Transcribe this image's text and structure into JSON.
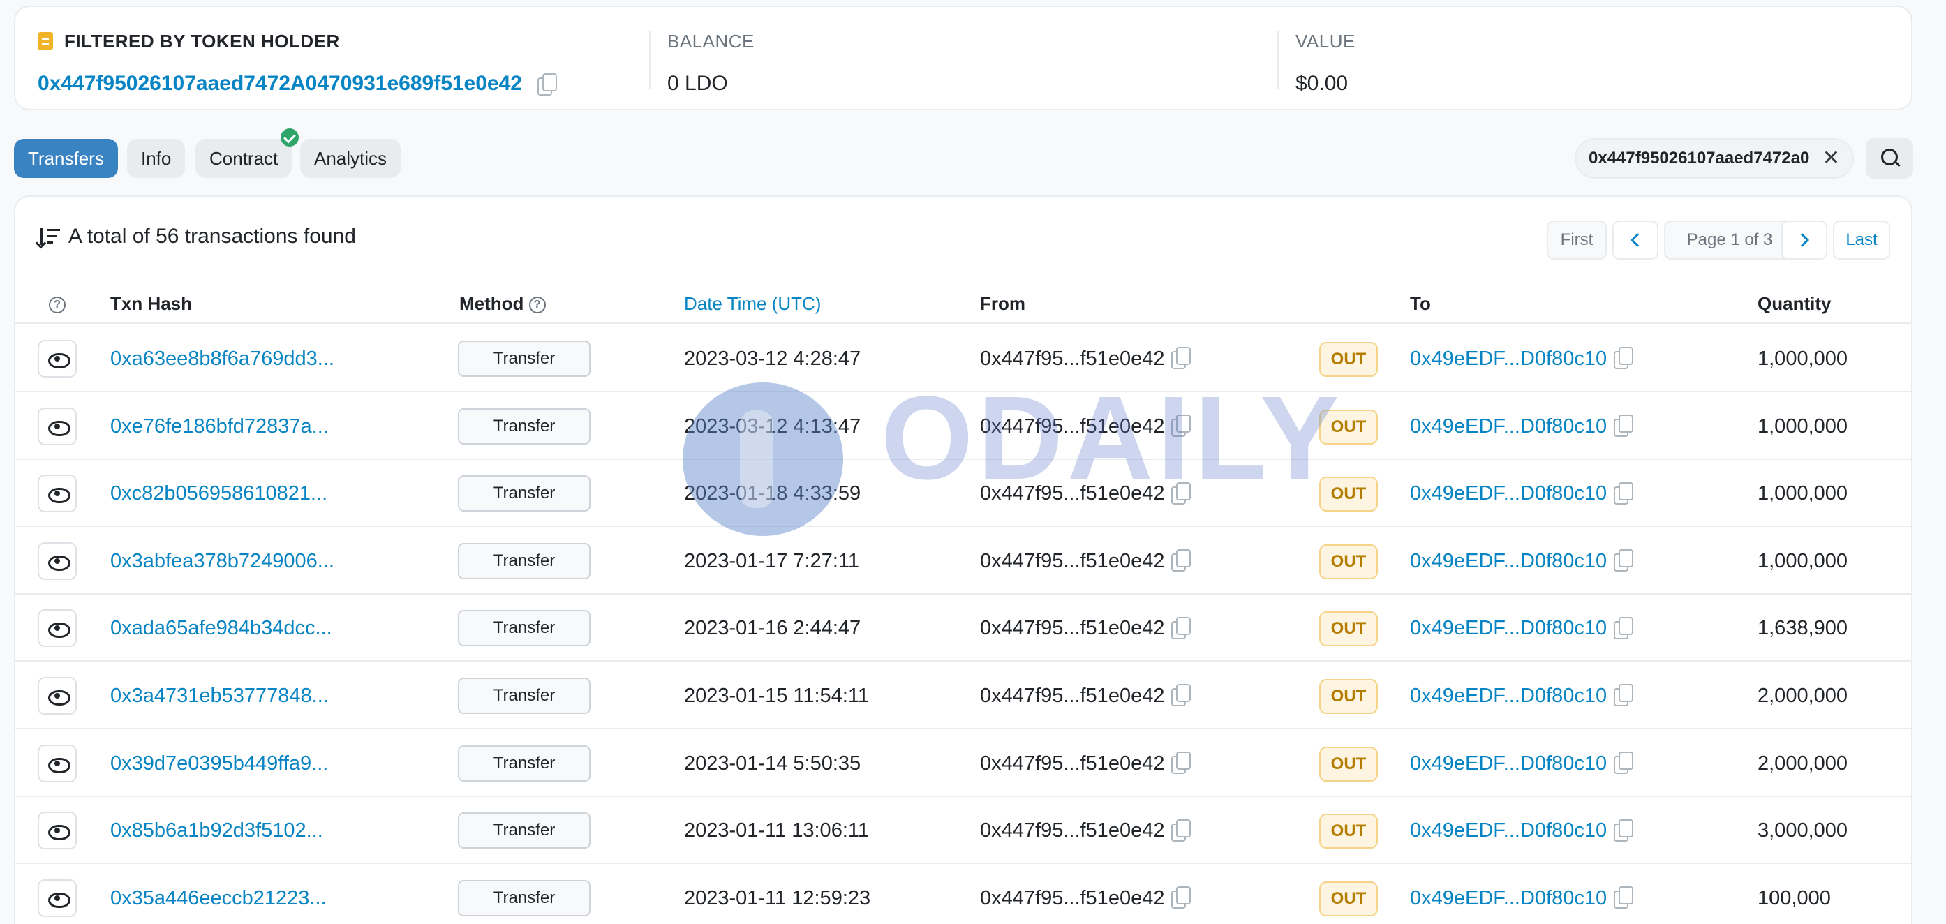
{
  "holder": {
    "label": "FILTERED BY TOKEN HOLDER",
    "address": "0x447f95026107aaed7472A0470931e689f51e0e42",
    "balance_label": "BALANCE",
    "balance_value": "0 LDO",
    "value_label": "VALUE",
    "value_value": "$0.00"
  },
  "tabs": [
    {
      "label": "Transfers",
      "active": true
    },
    {
      "label": "Info"
    },
    {
      "label": "Contract",
      "verified": true
    },
    {
      "label": "Analytics"
    }
  ],
  "filter": {
    "value": "0x447f95026107aaed7472a0",
    "clear": "✕"
  },
  "summary": "A total of 56 transactions found",
  "pager": {
    "first": "First",
    "page": "Page 1 of 3",
    "last": "Last"
  },
  "columns": {
    "help": "?",
    "txn_hash": "Txn Hash",
    "method": "Method",
    "datetime": "Date Time (UTC)",
    "from": "From",
    "to": "To",
    "quantity": "Quantity"
  },
  "rows": [
    {
      "hash": "0xa63ee8b8f6a769dd3...",
      "method": "Transfer",
      "datetime": "2023-03-12 4:28:47",
      "from": "0x447f95...f51e0e42",
      "dir": "OUT",
      "to": "0x49eEDF...D0f80c10",
      "qty": "1,000,000"
    },
    {
      "hash": "0xe76fe186bfd72837a...",
      "method": "Transfer",
      "datetime": "2023-03-12 4:13:47",
      "from": "0x447f95...f51e0e42",
      "dir": "OUT",
      "to": "0x49eEDF...D0f80c10",
      "qty": "1,000,000"
    },
    {
      "hash": "0xc82b056958610821...",
      "method": "Transfer",
      "datetime": "2023-01-18 4:33:59",
      "from": "0x447f95...f51e0e42",
      "dir": "OUT",
      "to": "0x49eEDF...D0f80c10",
      "qty": "1,000,000"
    },
    {
      "hash": "0x3abfea378b7249006...",
      "method": "Transfer",
      "datetime": "2023-01-17 7:27:11",
      "from": "0x447f95...f51e0e42",
      "dir": "OUT",
      "to": "0x49eEDF...D0f80c10",
      "qty": "1,000,000"
    },
    {
      "hash": "0xada65afe984b34dcc...",
      "method": "Transfer",
      "datetime": "2023-01-16 2:44:47",
      "from": "0x447f95...f51e0e42",
      "dir": "OUT",
      "to": "0x49eEDF...D0f80c10",
      "qty": "1,638,900"
    },
    {
      "hash": "0x3a4731eb53777848...",
      "method": "Transfer",
      "datetime": "2023-01-15 11:54:11",
      "from": "0x447f95...f51e0e42",
      "dir": "OUT",
      "to": "0x49eEDF...D0f80c10",
      "qty": "2,000,000"
    },
    {
      "hash": "0x39d7e0395b449ffa9...",
      "method": "Transfer",
      "datetime": "2023-01-14 5:50:35",
      "from": "0x447f95...f51e0e42",
      "dir": "OUT",
      "to": "0x49eEDF...D0f80c10",
      "qty": "2,000,000"
    },
    {
      "hash": "0x85b6a1b92d3f5102...",
      "method": "Transfer",
      "datetime": "2023-01-11 13:06:11",
      "from": "0x447f95...f51e0e42",
      "dir": "OUT",
      "to": "0x49eEDF...D0f80c10",
      "qty": "3,000,000"
    },
    {
      "hash": "0x35a446eeccb21223...",
      "method": "Transfer",
      "datetime": "2023-01-11 12:59:23",
      "from": "0x447f95...f51e0e42",
      "dir": "OUT",
      "to": "0x49eEDF...D0f80c10",
      "qty": "100,000"
    }
  ],
  "watermark": "ODAILY",
  "colors": {
    "link": "#0784c3",
    "active_tab": "#3a83c3",
    "out_badge": "#b47d00",
    "verified": "#2ea56a"
  },
  "icons": [
    "holder-icon",
    "copy-icon",
    "check-icon",
    "close-icon",
    "search-icon",
    "sort-icon",
    "chevron-left-icon",
    "chevron-right-icon",
    "question-icon",
    "eye-icon"
  ]
}
